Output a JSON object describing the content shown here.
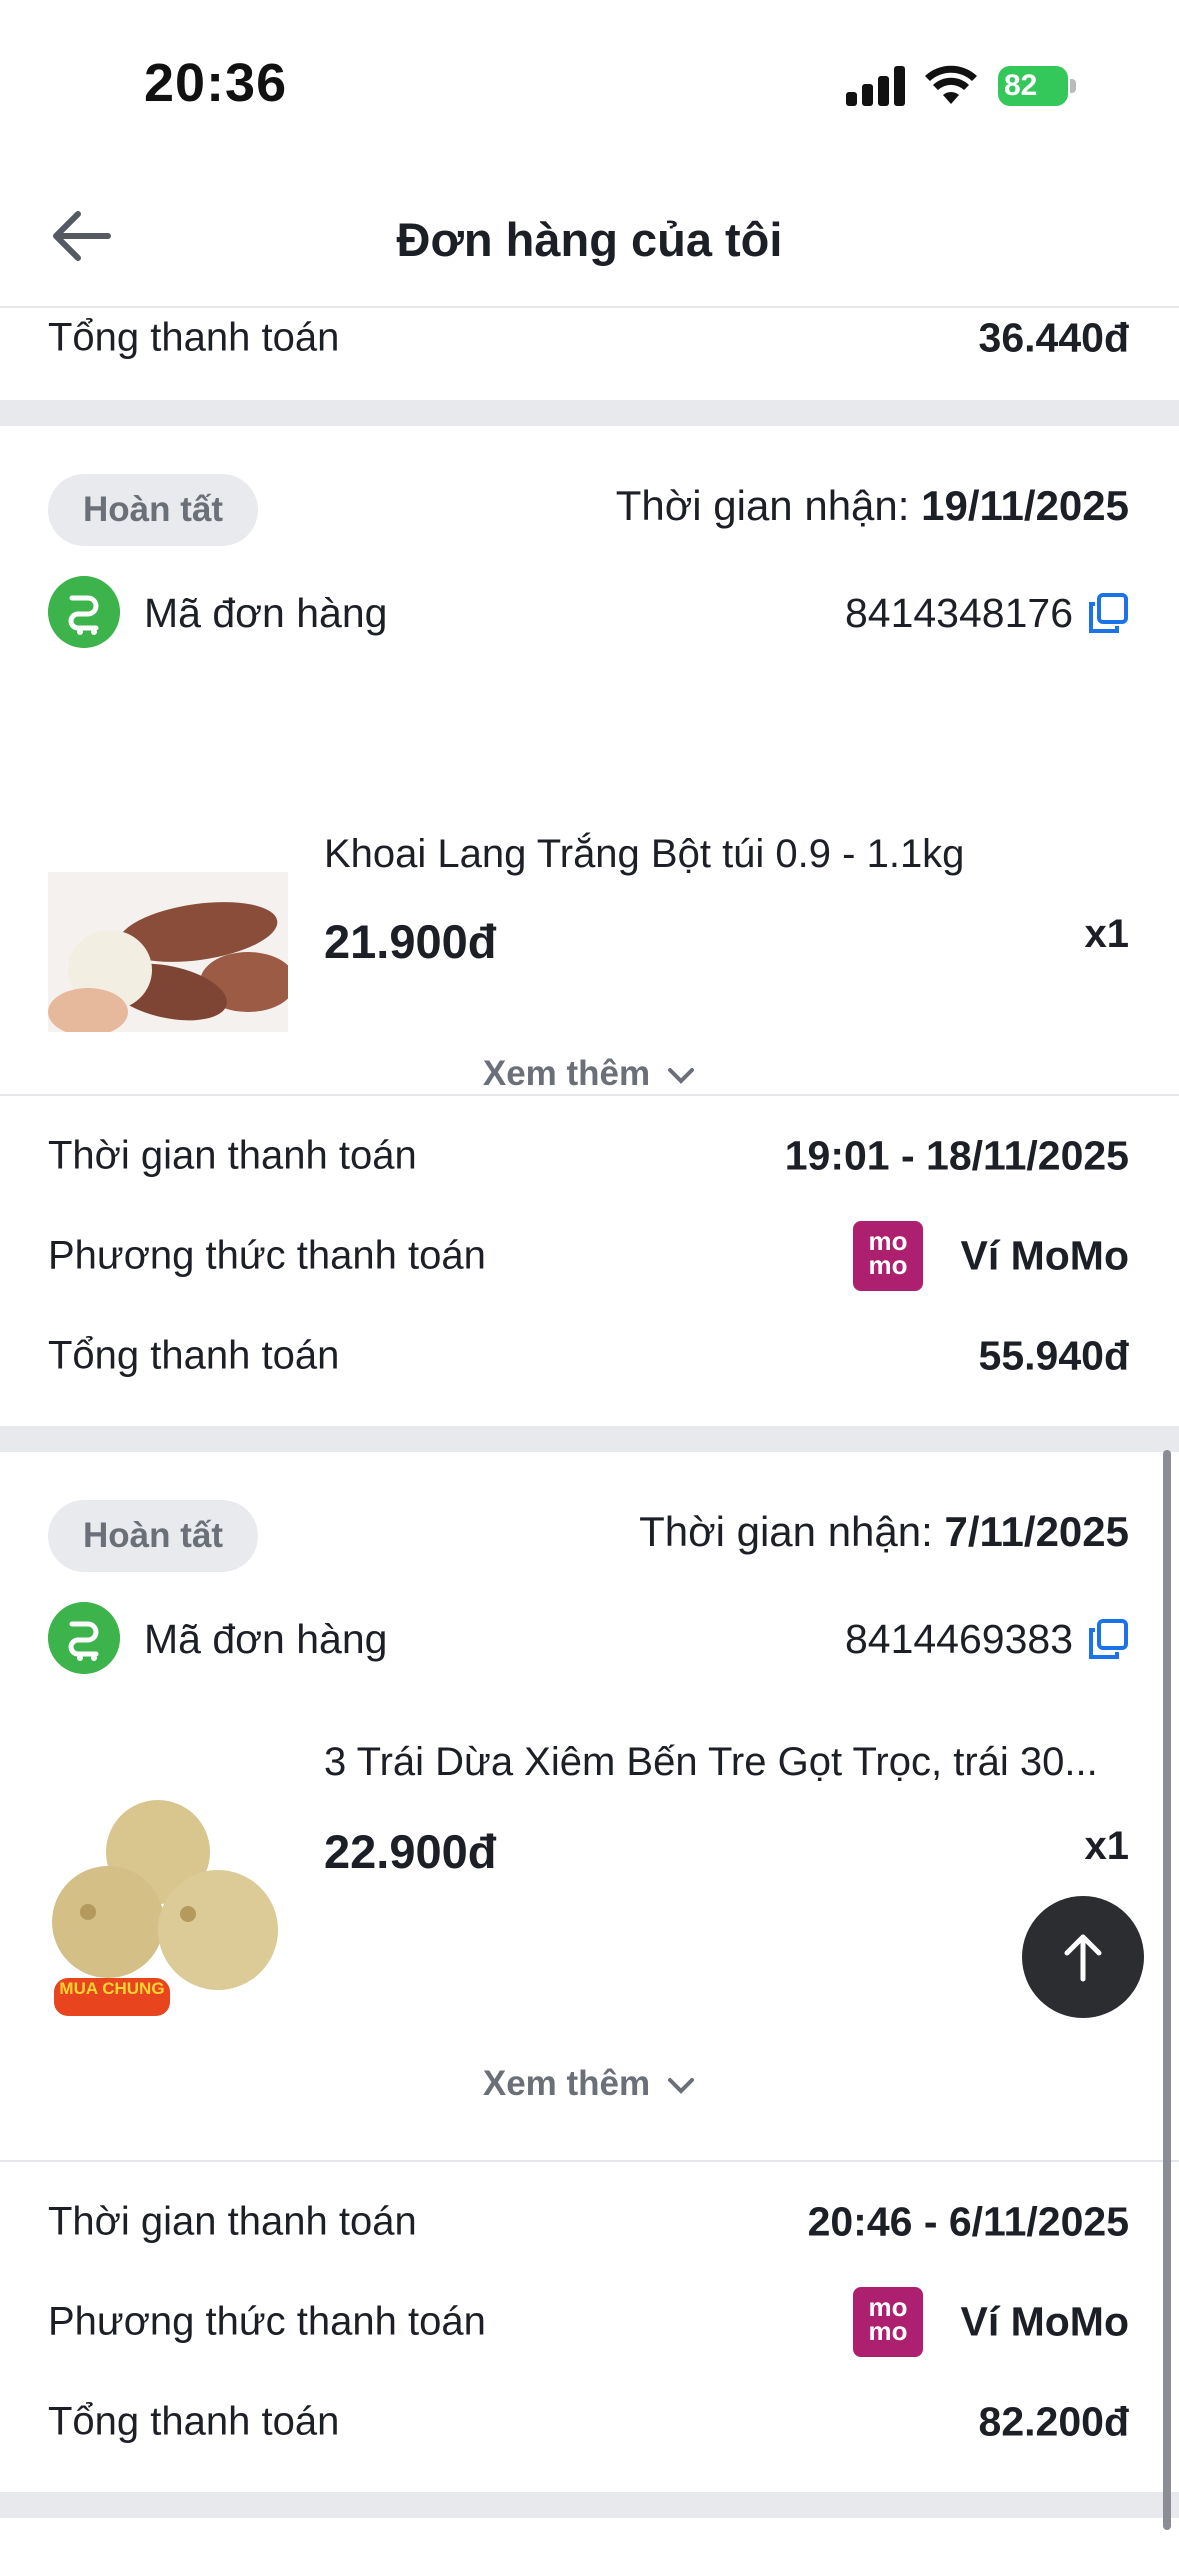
{
  "status_bar": {
    "time": "20:36",
    "battery": "82"
  },
  "header": {
    "title": "Đơn hàng của tôi"
  },
  "previous_order": {
    "total_label": "Tổng thanh toán",
    "total_value": "36.440đ"
  },
  "orders": [
    {
      "status": "Hoàn tất",
      "receive_label": "Thời gian nhận:",
      "receive_date": "19/11/2025",
      "order_code_label": "Mã đơn hàng",
      "order_code": "8414348176",
      "product_name": "Khoai Lang Trắng Bột túi 0.9 - 1.1kg",
      "price": "21.900đ",
      "qty": "x1",
      "more_label": "Xem thêm",
      "payment_time_label": "Thời gian thanh toán",
      "payment_time": "19:01 - 18/11/2025",
      "payment_method_label": "Phương thức thanh toán",
      "payment_method": "Ví MoMo",
      "total_label": "Tổng thanh toán",
      "total_value": "55.940đ"
    },
    {
      "status": "Hoàn tất",
      "receive_label": "Thời gian nhận:",
      "receive_date": "7/11/2025",
      "order_code_label": "Mã đơn hàng",
      "order_code": "8414469383",
      "product_name": "3 Trái Dừa Xiêm Bến Tre Gọt Trọc, trái 30...",
      "price": "22.900đ",
      "qty": "x1",
      "badge_text": "MUA CHUNG",
      "more_label": "Xem thêm",
      "payment_time_label": "Thời gian thanh toán",
      "payment_time": "20:46 - 6/11/2025",
      "payment_method_label": "Phương thức thanh toán",
      "payment_method": "Ví MoMo",
      "total_label": "Tổng thanh toán",
      "total_value": "82.200đ"
    }
  ],
  "momo_logo": {
    "line1": "mo",
    "line2": "mo"
  },
  "colors": {
    "green": "#3cb44b",
    "momo": "#ad1f6f",
    "link_blue": "#1a73e8"
  }
}
